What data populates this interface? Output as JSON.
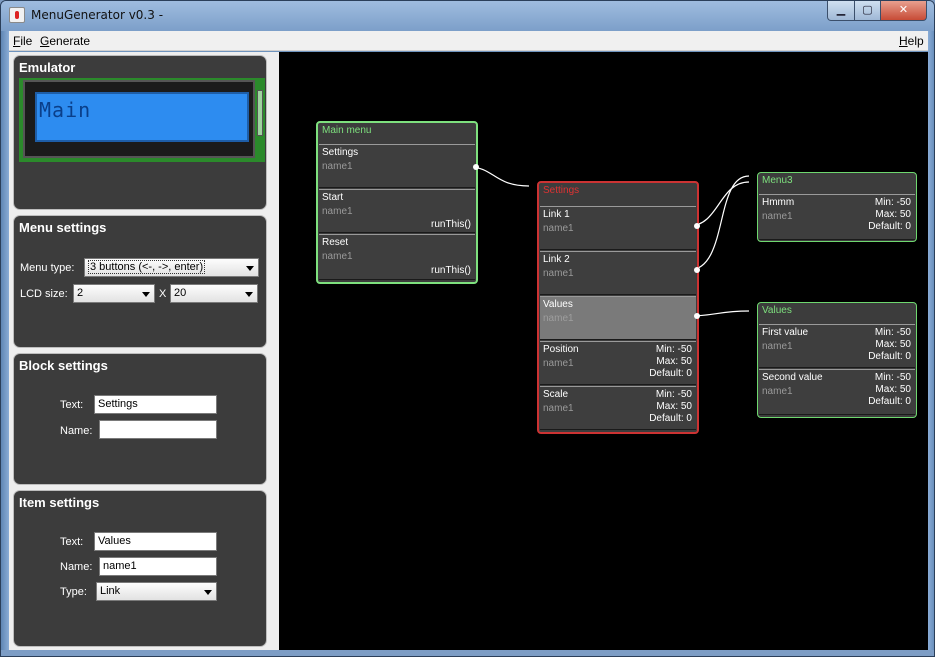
{
  "window": {
    "title": "MenuGenerator v0.3 -",
    "minimize_glyph": "▁",
    "maximize_glyph": "▢",
    "close_glyph": "✕",
    "app_icon": "java-cup-icon"
  },
  "menubar": {
    "file": "File",
    "generate": "Generate",
    "help": "Help"
  },
  "emulator": {
    "title": "Emulator",
    "lcd_text": "Main"
  },
  "menu_settings": {
    "title": "Menu settings",
    "menu_type_label": "Menu type:",
    "menu_type_value": "3 buttons (<-, ->, enter)",
    "lcd_size_label": "LCD size:",
    "lcd_rows": "2",
    "x_label": "X",
    "lcd_cols": "20"
  },
  "block_settings": {
    "title": "Block settings",
    "text_label": "Text:",
    "text_value": "Settings",
    "name_label": "Name:",
    "name_value": ""
  },
  "item_settings": {
    "title": "Item settings",
    "text_label": "Text:",
    "text_value": "Values",
    "name_label": "Name:",
    "name_value": "name1",
    "type_label": "Type:",
    "type_value": "Link"
  },
  "canvas": {
    "blocks": [
      {
        "title": "Main menu",
        "items": [
          {
            "text": "Settings",
            "name": "name1",
            "right": ""
          },
          {
            "text": "Start",
            "name": "name1",
            "right": "runThis()"
          },
          {
            "text": "Reset",
            "name": "name1",
            "right": "runThis()"
          }
        ]
      },
      {
        "title": "Settings",
        "items": [
          {
            "text": "Link 1",
            "name": "name1"
          },
          {
            "text": "Link 2",
            "name": "name1"
          },
          {
            "text": "Values",
            "name": "name1"
          },
          {
            "text": "Position",
            "name": "name1",
            "min": "Min: -50",
            "max": "Max: 50",
            "def": "Default: 0"
          },
          {
            "text": "Scale",
            "name": "name1",
            "min": "Min: -50",
            "max": "Max: 50",
            "def": "Default: 0"
          }
        ]
      },
      {
        "title": "Menu3",
        "items": [
          {
            "text": "Hmmm",
            "name": "name1",
            "min": "Min: -50",
            "max": "Max: 50",
            "def": "Default: 0"
          }
        ]
      },
      {
        "title": "Values",
        "items": [
          {
            "text": "First value",
            "name": "name1",
            "min": "Min: -50",
            "max": "Max: 50",
            "def": "Default: 0"
          },
          {
            "text": "Second value",
            "name": "name1",
            "min": "Min: -50",
            "max": "Max: 50",
            "def": "Default: 0"
          }
        ]
      }
    ],
    "colors": {
      "background": "#000000",
      "block_fill": "#3c3c3c",
      "selected_block_border": "#cc3333",
      "block_border": "#7ee07e",
      "selected_item": "#7a7a7a",
      "connector": "#ffffff"
    }
  }
}
